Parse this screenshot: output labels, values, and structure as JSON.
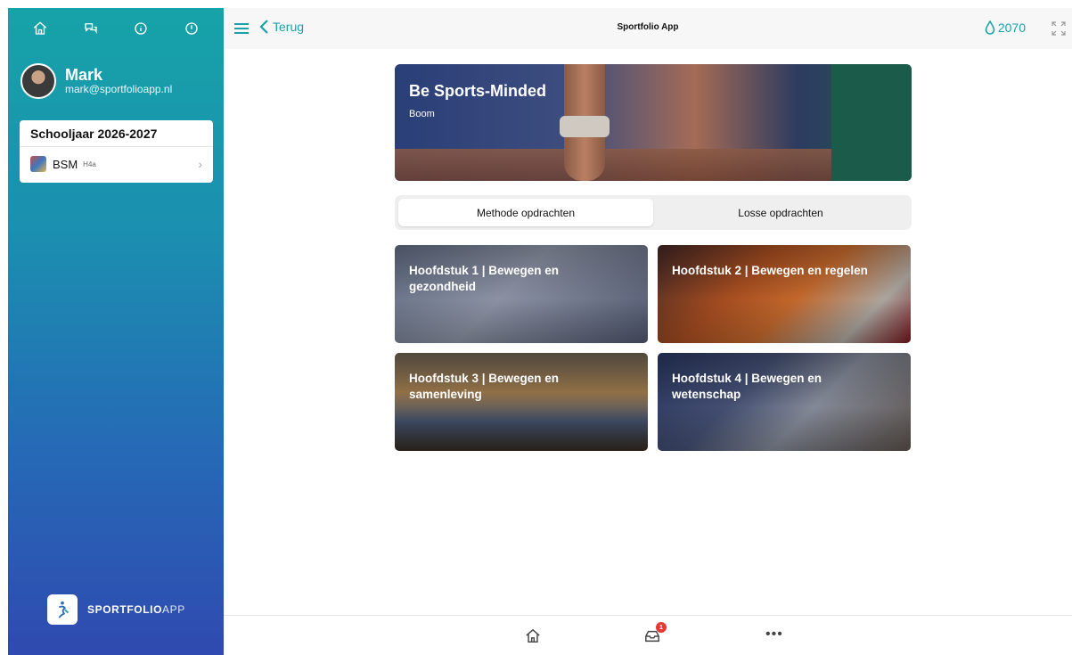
{
  "sidebar": {
    "top_icons": [
      "home-icon",
      "chat-icon",
      "info-icon",
      "alert-icon"
    ],
    "profile": {
      "name": "Mark",
      "email": "mark@sportfolioapp.nl"
    },
    "school_year": "Schooljaar 2026-2027",
    "class_item": {
      "name": "BSM",
      "group": "H4a"
    },
    "brand": {
      "bold": "SPORTFOLIO",
      "light": "APP"
    }
  },
  "topbar": {
    "back_label": "Terug",
    "title": "Sportfolio App",
    "drops_count": "2070"
  },
  "hero": {
    "title": "Be Sports-Minded",
    "subtitle": "Boom"
  },
  "segments": {
    "active": "Methode opdrachten",
    "inactive": "Losse opdrachten"
  },
  "chapters": [
    {
      "title": "Hoofdstuk 1 | Bewegen en gezondheid"
    },
    {
      "title": "Hoofdstuk 2 | Bewegen en regelen"
    },
    {
      "title": "Hoofdstuk 3 | Bewegen en samenleving"
    },
    {
      "title": "Hoofdstuk 4 | Bewegen en wetenschap"
    }
  ],
  "tabbar": {
    "inbox_badge": "1",
    "icons": [
      "home-icon",
      "inbox-icon",
      "more-icon"
    ]
  },
  "colors": {
    "accent": "#1aa2a8",
    "sidebar_top": "#16a3a8",
    "sidebar_bottom": "#2f4ab0",
    "badge": "#e53935"
  }
}
